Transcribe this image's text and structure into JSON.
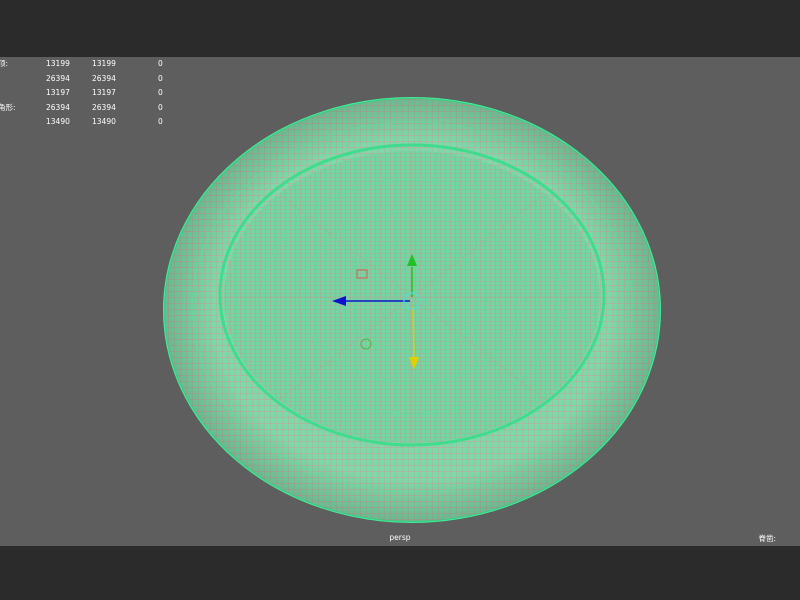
{
  "hud": {
    "rows": [
      {
        "label": "顶:",
        "v1": "13199",
        "v2": "13199",
        "v3": "0"
      },
      {
        "label": "",
        "v1": "26394",
        "v2": "26394",
        "v3": "0"
      },
      {
        "label": "",
        "v1": "13197",
        "v2": "13197",
        "v3": "0"
      },
      {
        "label": "角形:",
        "v1": "26394",
        "v2": "26394",
        "v3": "0"
      },
      {
        "label": ":",
        "v1": "13490",
        "v2": "13490",
        "v3": "0"
      }
    ]
  },
  "viewport": {
    "camera": "persp",
    "right_label": "脊凿:"
  },
  "colors": {
    "background": "#5e5e5e",
    "wireframe": "#6ee8b4",
    "x_axis": "#1010d0",
    "y_axis": "#22c022",
    "z_axis": "#e0d000"
  }
}
